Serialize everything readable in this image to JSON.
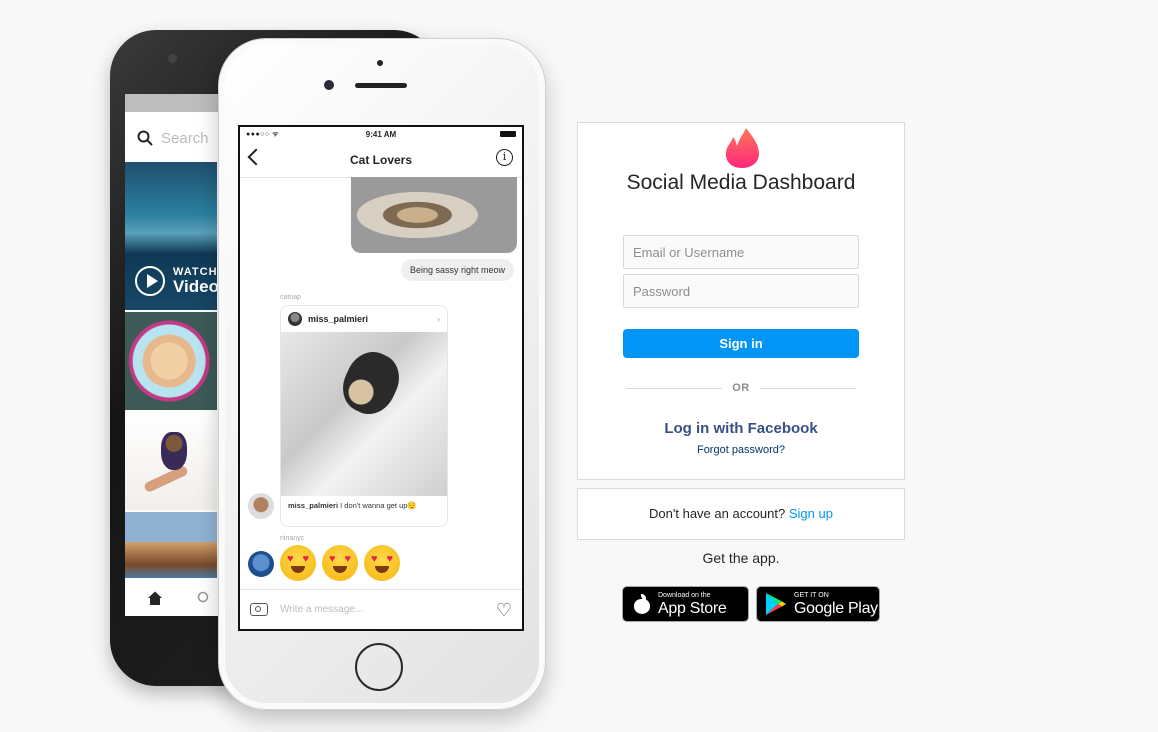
{
  "back_phone": {
    "search_placeholder": "Search",
    "watch_small": "WATCH",
    "watch_big": "Video"
  },
  "front_phone": {
    "status_carrier": "●●●○○ ᯤ",
    "status_time": "9:41 AM",
    "chat_title": "Cat Lovers",
    "sent_message": "Being sassy right meow",
    "shared_by": "catnap",
    "share_username": "miss_palmieri",
    "share_caption_user": "miss_palmieri",
    "share_caption_text": " I don't wanna get up😌",
    "reaction_sender": "ninanyc",
    "message_placeholder": "Write a message..."
  },
  "login": {
    "app_title": "Social Media Dashboard",
    "email_placeholder": "Email or Username",
    "password_placeholder": "Password",
    "signin_label": "Sign in",
    "or_label": "OR",
    "facebook_label": "Log in with Facebook",
    "forgot_label": "Forgot password?",
    "logo_icon": "flame-icon",
    "colors": {
      "primary": "#0095f6",
      "facebook": "#385185",
      "flame_top": "#ff7854",
      "flame_bottom": "#fd267d"
    }
  },
  "signup": {
    "prompt": "Don't have an account? ",
    "link": "Sign up"
  },
  "get_app": {
    "label": "Get the app.",
    "apple_small": "Download on the",
    "apple_big": "App Store",
    "google_small": "GET IT ON",
    "google_big": "Google Play"
  }
}
